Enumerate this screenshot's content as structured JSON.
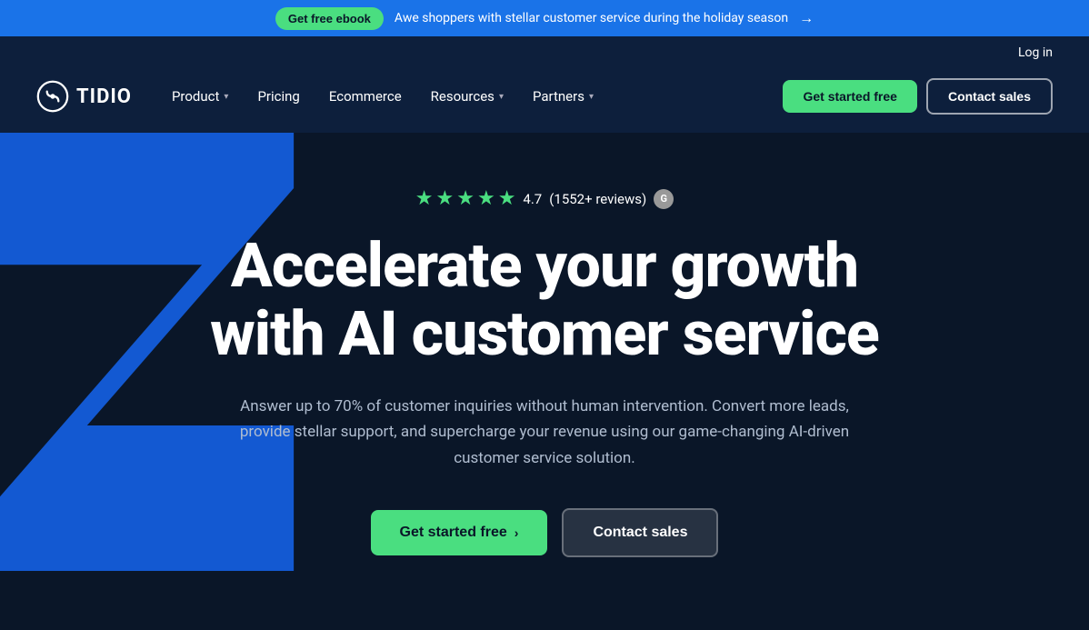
{
  "banner": {
    "ebook_button": "Get free ebook",
    "text": "Awe shoppers with stellar customer service during the holiday season",
    "arrow": "→"
  },
  "header": {
    "login_label": "Log in",
    "logo_text": "TIDIO",
    "nav": [
      {
        "label": "Product",
        "has_dropdown": true
      },
      {
        "label": "Pricing",
        "has_dropdown": false
      },
      {
        "label": "Ecommerce",
        "has_dropdown": false
      },
      {
        "label": "Resources",
        "has_dropdown": true
      },
      {
        "label": "Partners",
        "has_dropdown": true
      }
    ],
    "cta_primary": "Get started free",
    "cta_secondary": "Contact sales"
  },
  "hero": {
    "rating_value": "4.7",
    "rating_count": "(1552+ reviews)",
    "title_line1": "Accelerate your growth",
    "title_line2": "with AI customer service",
    "subtitle": "Answer up to 70% of customer inquiries without human intervention. Convert more leads, provide stellar support, and supercharge your revenue using our game-changing AI-driven customer service solution.",
    "cta_primary": "Get started free",
    "cta_secondary": "Contact sales",
    "arrow": "›"
  }
}
